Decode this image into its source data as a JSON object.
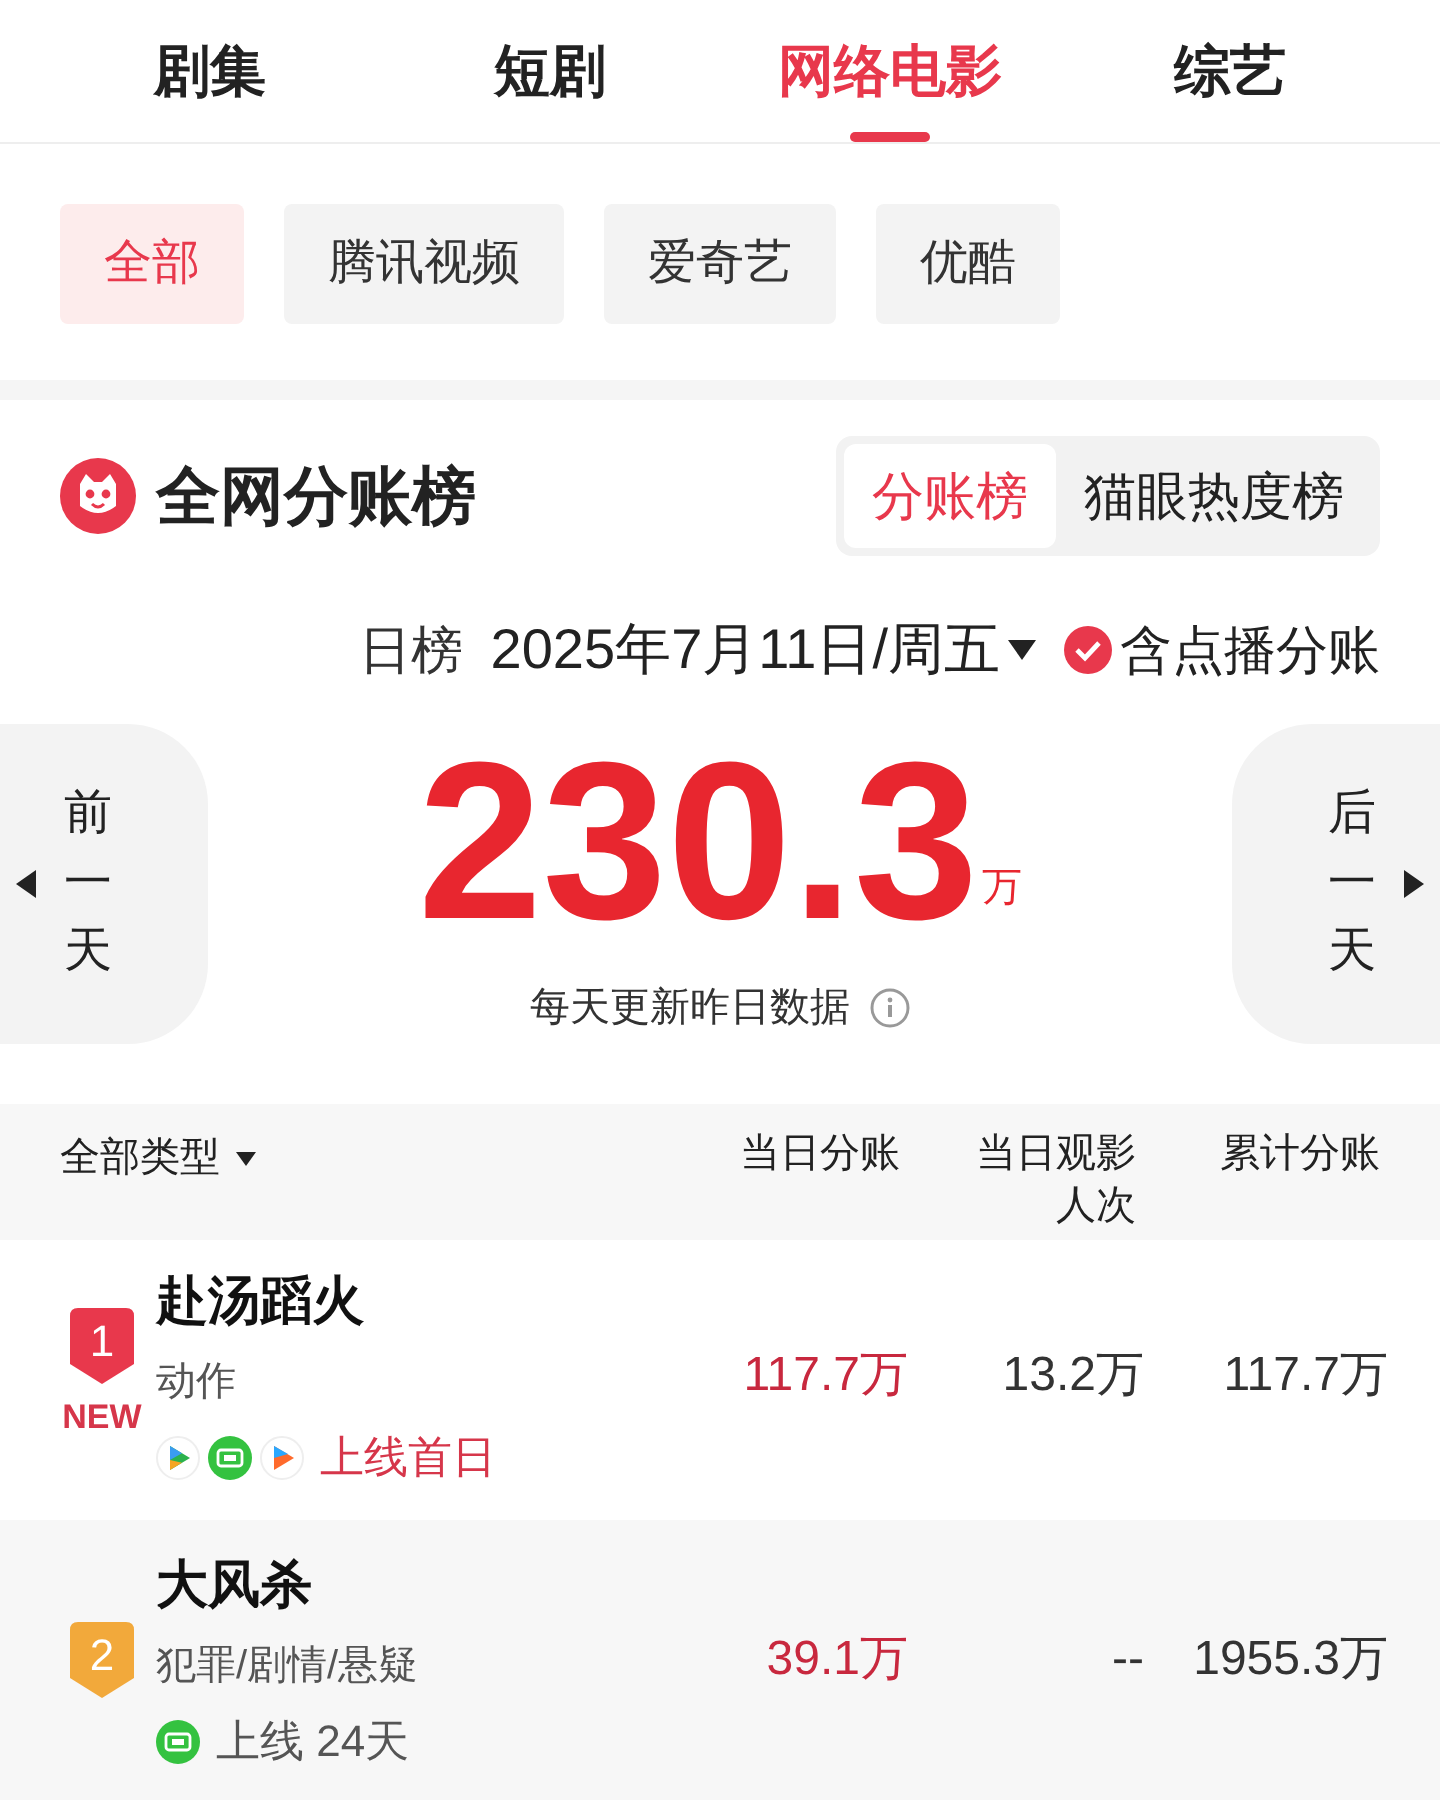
{
  "top_tabs": [
    {
      "label": "剧集",
      "selected": false
    },
    {
      "label": "短剧",
      "selected": false
    },
    {
      "label": "网络电影",
      "selected": true
    },
    {
      "label": "综艺",
      "selected": false
    }
  ],
  "platform_filters": [
    {
      "label": "全部",
      "selected": true
    },
    {
      "label": "腾讯视频",
      "selected": false
    },
    {
      "label": "爱奇艺",
      "selected": false
    },
    {
      "label": "优酷",
      "selected": false
    }
  ],
  "board": {
    "title": "全网分账榜",
    "switch": [
      {
        "label": "分账榜",
        "selected": true
      },
      {
        "label": "猫眼热度榜",
        "selected": false
      }
    ],
    "date_label": "日榜",
    "date": "2025年7月11日/周五",
    "include_vod": {
      "label": "含点播分账",
      "checked": true
    },
    "prev": "前一天",
    "next": "后一天",
    "total": "230.3",
    "total_unit": "万",
    "note": "每天更新昨日数据"
  },
  "table": {
    "filter": "全部类型",
    "columns": [
      "当日分账",
      "当日观影人次",
      "累计分账"
    ],
    "rows": [
      {
        "rank": "1",
        "color": "#e8384c",
        "new": "NEW",
        "title": "赴汤蹈火",
        "genre": "动作",
        "platforms": [
          {
            "kind": "tencent"
          },
          {
            "kind": "iqiyi"
          },
          {
            "kind": "youku"
          }
        ],
        "status": "上线首日",
        "status_highlight": true,
        "day": "117.7万",
        "viewers": "13.2万",
        "total": "117.7万"
      },
      {
        "rank": "2",
        "color": "#f2a93b",
        "title": "大风杀",
        "genre": "犯罪/剧情/悬疑",
        "platforms": [
          {
            "kind": "iqiyi"
          }
        ],
        "status": "上线 24天",
        "status_highlight": false,
        "day": "39.1万",
        "viewers": "--",
        "total": "1955.3万"
      }
    ]
  }
}
